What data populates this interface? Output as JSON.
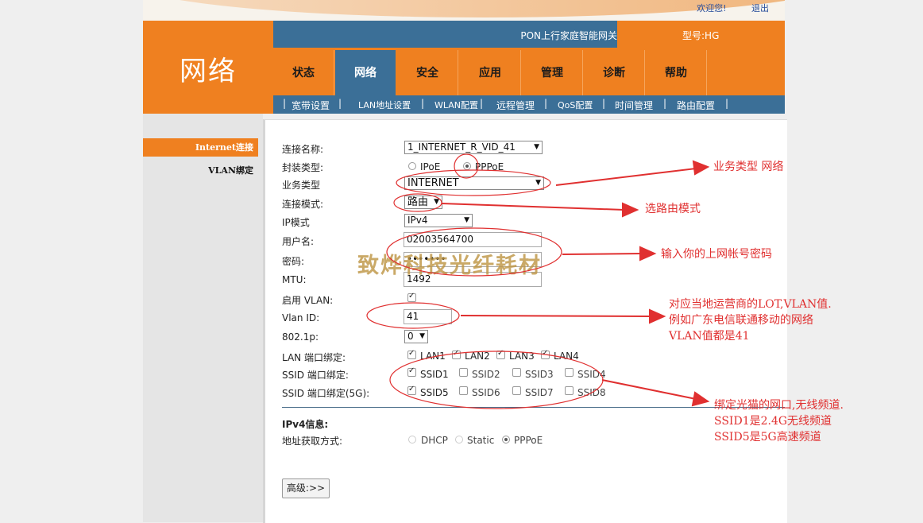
{
  "header": {
    "top_links": [
      "欢迎您!",
      "退出"
    ],
    "logo_text": "网络",
    "gateway_title": "PON上行家庭智能网关",
    "model": "型号:HG"
  },
  "nav": {
    "tabs": [
      "状态",
      "网络",
      "安全",
      "应用",
      "管理",
      "诊断",
      "帮助"
    ],
    "active": "网络"
  },
  "subnav": {
    "items": [
      "宽带设置",
      "LAN地址设置",
      "WLAN配置",
      "远程管理",
      "QoS配置",
      "时间管理",
      "路由配置"
    ]
  },
  "leftnav": {
    "items": [
      "Internet连接",
      "VLAN绑定"
    ],
    "active": "Internet连接"
  },
  "form": {
    "connection_name_label": "连接名称:",
    "connection_name_value": "1_INTERNET_R_VID_41",
    "encap_label": "封装类型:",
    "encap_options": [
      "IPoE",
      "PPPoE"
    ],
    "encap_selected": "PPPoE",
    "service_label": "业务类型",
    "service_value": "INTERNET",
    "mode_label": "连接模式:",
    "mode_value": "路由",
    "ipmode_label": "IP模式",
    "ipmode_value": "IPv4",
    "username_label": "用户名:",
    "username_value": "02003564700",
    "password_label": "密码:",
    "password_value": "•••••••",
    "mtu_label": "MTU:",
    "mtu_value": "1492",
    "vlan_enable_label": "启用 VLAN:",
    "vlan_enable_checked": true,
    "vlan_id_label": "Vlan ID:",
    "vlan_id_value": "41",
    "dot1p_label": "802.1p:",
    "dot1p_value": "0",
    "lan_bind_label": "LAN 端口绑定:",
    "lan_ports": [
      {
        "label": "LAN1",
        "checked": true
      },
      {
        "label": "LAN2",
        "checked": true
      },
      {
        "label": "LAN3",
        "checked": true
      },
      {
        "label": "LAN4",
        "checked": true
      }
    ],
    "ssid_bind_label": "SSID 端口绑定:",
    "ssid_ports": [
      {
        "label": "SSID1",
        "checked": true
      },
      {
        "label": "SSID2",
        "checked": false
      },
      {
        "label": "SSID3",
        "checked": false
      },
      {
        "label": "SSID4",
        "checked": false
      }
    ],
    "ssid5g_bind_label": "SSID 端口绑定(5G):",
    "ssid5g_ports": [
      {
        "label": "SSID5",
        "checked": true
      },
      {
        "label": "SSID6",
        "checked": false
      },
      {
        "label": "SSID7",
        "checked": false
      },
      {
        "label": "SSID8",
        "checked": false
      }
    ],
    "ipv4_section_title": "IPv4信息:",
    "addr_label": "地址获取方式:",
    "addr_options": [
      "DHCP",
      "Static",
      "PPPoE"
    ],
    "addr_selected": "PPPoE",
    "advanced_button": "高级:>>"
  },
  "annotations": {
    "note_service": "业务类型  网络",
    "note_route": "选路由模式",
    "note_account": "输入你的上网帐号密码",
    "note_vlan": [
      "对应当地运营商的LOT,VLAN值.",
      "例如广东电信联通移动的网络",
      "VLAN值都是41"
    ],
    "note_bind": [
      "绑定光猫的网口,无线频道.",
      "SSID1是2.4G无线频道",
      "SSID5是5G高速频道"
    ],
    "watermark": "致烨科技光纤耗材",
    "color": "#e03030"
  }
}
